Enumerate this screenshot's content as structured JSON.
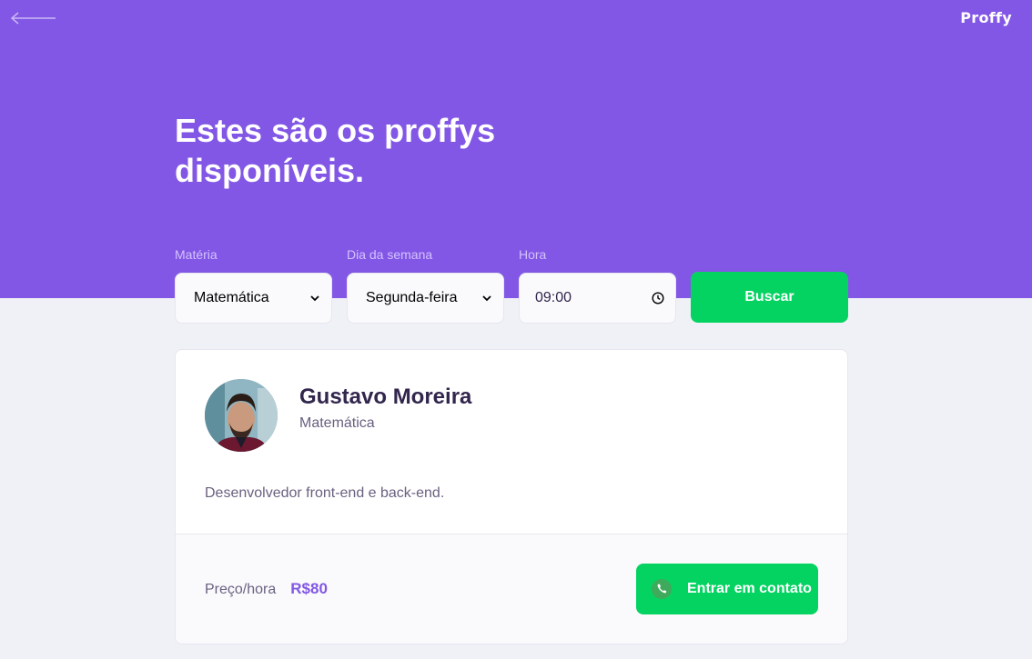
{
  "header": {
    "logo": "Proffy",
    "title": "Estes são os proffys disponíveis."
  },
  "filters": {
    "subject": {
      "label": "Matéria",
      "value": "Matemática"
    },
    "weekday": {
      "label": "Dia da semana",
      "value": "Segunda-feira"
    },
    "time": {
      "label": "Hora",
      "value": "09:00"
    },
    "search_label": "Buscar"
  },
  "teacher": {
    "name": "Gustavo Moreira",
    "subject": "Matemática",
    "bio": "Desenvolvedor front-end e back-end.",
    "price_label": "Preço/hora",
    "price_value": "R$80",
    "contact_label": "Entrar em contato"
  },
  "colors": {
    "primary": "#8257E5",
    "accent_green": "#04D361",
    "background": "#F0F0F7"
  },
  "icons": {
    "back": "arrow-left-icon",
    "select": "chevron-down-icon",
    "time": "clock-icon",
    "contact": "whatsapp-icon"
  }
}
